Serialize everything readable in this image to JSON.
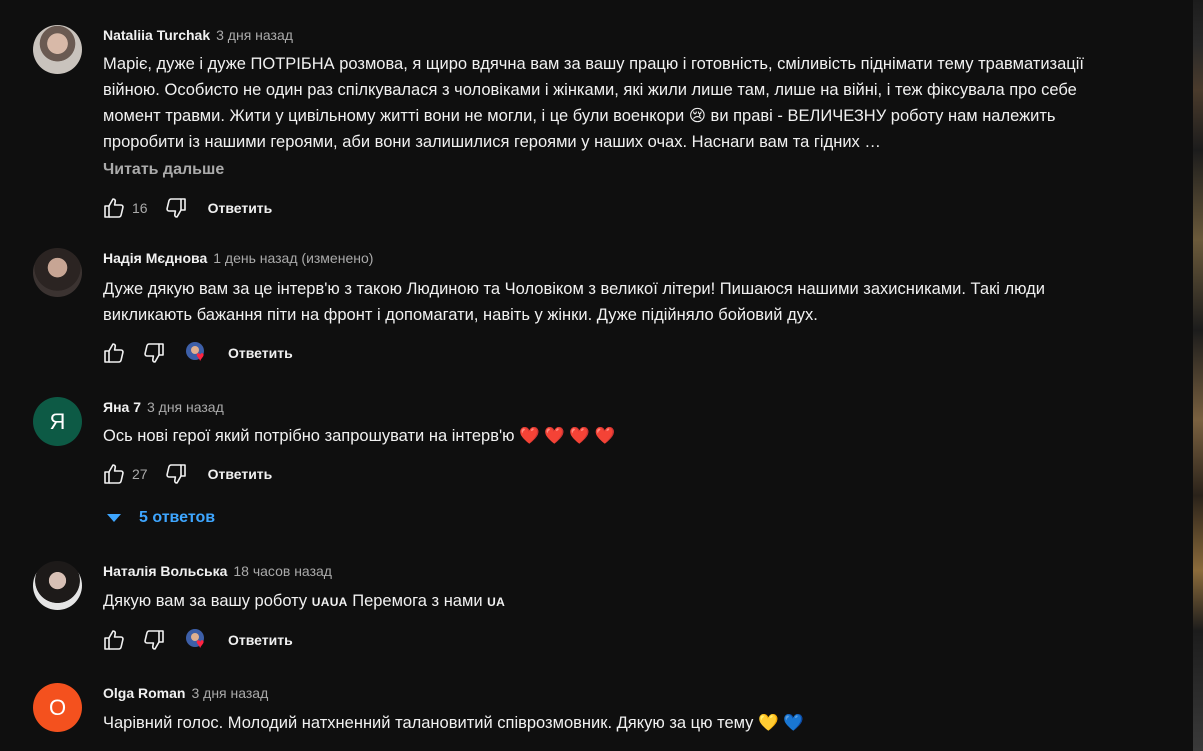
{
  "ui": {
    "reply_label": "Ответить",
    "read_more_label": "Читать дальше"
  },
  "comments": [
    {
      "author": "Nataliia Turchak",
      "time": "3 дня назад",
      "text": "Марiє, дуже i дуже ПОТРІБНА розмова, я щиро вдячна вам за вашу працю і готовність, сміливість піднімати тему травматизації війною. Особисто не один раз спілкувалася з чоловіками і жінками, які жили лише там, лише на війні, і теж фіксувала про себе момент травми. Жити у цивільному житті вони не могли, і це були военкори 😢  ви праві - ВЕЛИЧЕЗНУ роботу нам належить проробити із нашими героями, аби вони залишилися героями у наших очах. Наснаги вам та гідних …",
      "likes": "16",
      "avatar": "photo"
    },
    {
      "author": "Надія Мєднова",
      "time": "1 день назад (изменено)",
      "text": "Дуже дякую вам за це інтерв'ю з такою Людиною та Чоловіком з великої літери! Пишаюся нашими захисниками. Такі люди викликають бажання піти на фронт і допомагати, навіть у жінки. Дуже підійняло бойовий дух.",
      "likes": "",
      "avatar": "photo"
    },
    {
      "author": "Яна 7",
      "time": "3 дня назад",
      "text": "Ось нові герої який потрібно запрошувати на інтерв'ю ❤️ ❤️ ❤️ ❤️",
      "likes": "27",
      "avatar_letter": "Я",
      "replies_label": "5 ответов"
    },
    {
      "author": "Наталія Вольська",
      "time": "18 часов назад",
      "text_a": "Дякую вам за вашу роботу ",
      "flag_a": "UAUA",
      "text_b": " Перемога з нами ",
      "flag_b": "UA",
      "likes": "",
      "avatar": "photo"
    },
    {
      "author": "Olga Roman",
      "time": "3 дня назад",
      "text": "Чарівний голос. Молодий натхненний талановитий співрозмовник. Дякую за цю тему 💛 💙",
      "avatar_letter": "O"
    }
  ],
  "colors": {
    "background": "#0f0f0f",
    "text": "#f1f1f1",
    "muted": "#aaaaaa",
    "link_blue": "#3ea6ff",
    "avatar_ya": "#0d5a45",
    "avatar_o": "#f4511e",
    "heart": "#ff2442"
  },
  "icons": [
    "thumbs-up-icon",
    "thumbs-down-icon",
    "creator-heart-icon",
    "chevron-down-icon"
  ]
}
